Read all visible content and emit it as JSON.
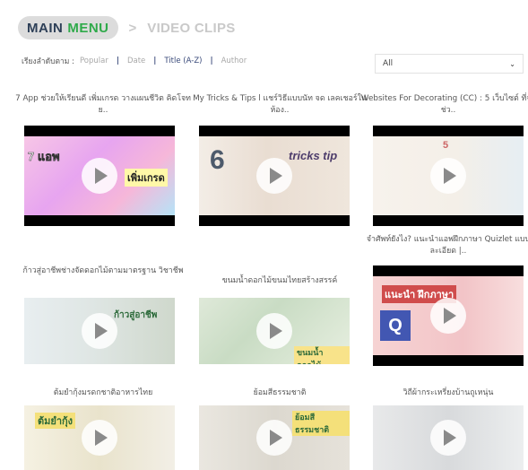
{
  "breadcrumb": {
    "main_word1": "MAIN",
    "main_word2": "MENU",
    "separator": ">",
    "current": "VIDEO CLIPS"
  },
  "sort": {
    "label": "เรียงลำดับตาม :",
    "options": [
      "Popular",
      "Date",
      "Title (A-Z)",
      "Author"
    ],
    "active": "Title (A-Z)"
  },
  "filter": {
    "selected": "All"
  },
  "videos": [
    {
      "title": "7 App ช่วยให้เรียนดี เพิ่มเกรด วางแผนชีวิต คิดโจทย..",
      "thumb_text": "เพิ่มเกรด"
    },
    {
      "title": "My Tricks & Tips l แชร์วิธีแบบนัท จด เลคเชอร์ในห้อง..",
      "thumb_text": "tricks tip"
    },
    {
      "title": "Websites For Decorating (CC) : 5 เว็บไซต์ ที่จะช่ว..",
      "thumb_text": ""
    },
    {
      "title": "จำศัพท์ยังไง? แนะนำแอพฝึกภาษา Quizlet แบบละเอียด |..",
      "thumb_text": "แนะนำ ฝึกภาษา"
    },
    {
      "title": "ก้าวสู่อาชีพช่างจัดดอกไม้ตามมาตรฐาน วิชาชีพ",
      "thumb_text": "ก้าวสู่อาชีพ"
    },
    {
      "title": "ขนมน้ำดอกไม้ขนมไทยสร้างสรรค์",
      "thumb_text": "ขนมน้ำดอกไม้"
    },
    {
      "title": "ต้มยำกุ้งมรดกชาติอาหารไทย",
      "thumb_text": "ต้มยำกุ้ง"
    },
    {
      "title": "ย้อมสีธรรมชาติ",
      "thumb_text": "ย้อมสีธรรมชาติ"
    },
    {
      "title": "วิถีผ้ากระเหรี่ยงบ้านถูเหนุ่น",
      "thumb_text": ""
    }
  ],
  "colors": {
    "brand_dark": "#2d3f57",
    "brand_green": "#2faa4a",
    "link_active": "#3a4a7a"
  }
}
